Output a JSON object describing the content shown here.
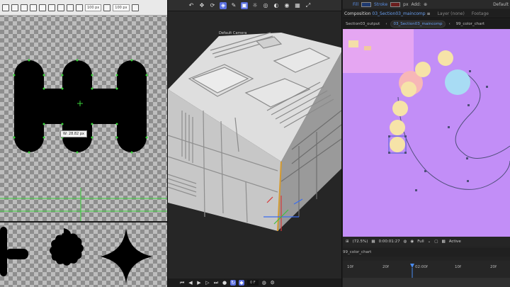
{
  "left_panel": {
    "toolbar": {
      "width_field": "100 px",
      "height_field": "100 px"
    },
    "size_tooltip": "W: 28.82 px"
  },
  "middle_panel": {
    "viewport_label": "Default Camera",
    "frame_field": "0 F",
    "accent_color": "#5a6fe0"
  },
  "right_panel": {
    "toolbar": {
      "fill_label": "Fill",
      "stroke_label": "Stroke",
      "px_label": "px",
      "add_label": "Add:",
      "workspace_label": "Default"
    },
    "tabs": {
      "composition_prefix": "Composition",
      "composition_name": "03_Section03_maincomp",
      "layer_label": "Layer (none)",
      "footage_label": "Footage"
    },
    "breadcrumbs": [
      "Section03_output",
      "03_Section03_maincomp",
      "99_color_chart"
    ],
    "status": {
      "zoom": "(72.5%)",
      "timecode": "0:00:01:27",
      "view_mode": "Full",
      "active_label": "Active"
    },
    "timeline": {
      "comp_name": "99_color_chart",
      "ticks": [
        "10f",
        "20f",
        "02:00f",
        "10f",
        "20f"
      ]
    },
    "comp_bg_color": "#c28ef7"
  }
}
